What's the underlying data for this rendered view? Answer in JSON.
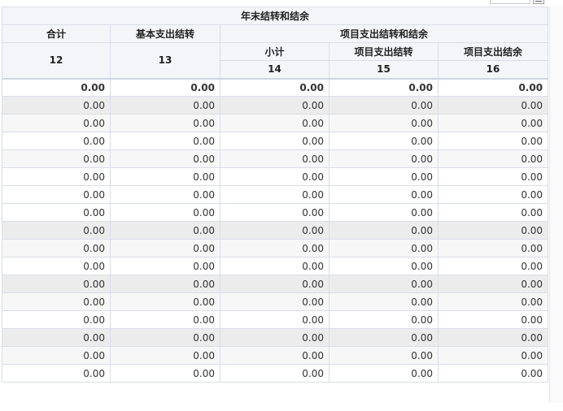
{
  "table": {
    "title": "年末结转和结余",
    "headers": {
      "total": "合计",
      "basic": "基本支出结转",
      "project_group": "项目支出结转和结余",
      "subtotal": "小计",
      "project_carry": "项目支出结转",
      "project_balance": "项目支出结余"
    },
    "codes": {
      "total": "12",
      "basic": "13",
      "subtotal": "14",
      "project_carry": "15",
      "project_balance": "16"
    },
    "rows": [
      [
        "0.00",
        "0.00",
        "0.00",
        "0.00",
        "0.00"
      ],
      [
        "0.00",
        "0.00",
        "0.00",
        "0.00",
        "0.00"
      ],
      [
        "0.00",
        "0.00",
        "0.00",
        "0.00",
        "0.00"
      ],
      [
        "0.00",
        "0.00",
        "0.00",
        "0.00",
        "0.00"
      ],
      [
        "0.00",
        "0.00",
        "0.00",
        "0.00",
        "0.00"
      ],
      [
        "0.00",
        "0.00",
        "0.00",
        "0.00",
        "0.00"
      ],
      [
        "0.00",
        "0.00",
        "0.00",
        "0.00",
        "0.00"
      ],
      [
        "0.00",
        "0.00",
        "0.00",
        "0.00",
        "0.00"
      ],
      [
        "0.00",
        "0.00",
        "0.00",
        "0.00",
        "0.00"
      ],
      [
        "0.00",
        "0.00",
        "0.00",
        "0.00",
        "0.00"
      ],
      [
        "0.00",
        "0.00",
        "0.00",
        "0.00",
        "0.00"
      ],
      [
        "0.00",
        "0.00",
        "0.00",
        "0.00",
        "0.00"
      ],
      [
        "0.00",
        "0.00",
        "0.00",
        "0.00",
        "0.00"
      ],
      [
        "0.00",
        "0.00",
        "0.00",
        "0.00",
        "0.00"
      ],
      [
        "0.00",
        "0.00",
        "0.00",
        "0.00",
        "0.00"
      ],
      [
        "0.00",
        "0.00",
        "0.00",
        "0.00",
        "0.00"
      ],
      [
        "0.00",
        "0.00",
        "0.00",
        "0.00",
        "0.00"
      ]
    ],
    "row_styles": [
      "first",
      "alt",
      "light",
      "",
      "light",
      "",
      "",
      "",
      "alt",
      "light",
      "",
      "alt",
      "light",
      "",
      "alt",
      "light",
      ""
    ]
  }
}
